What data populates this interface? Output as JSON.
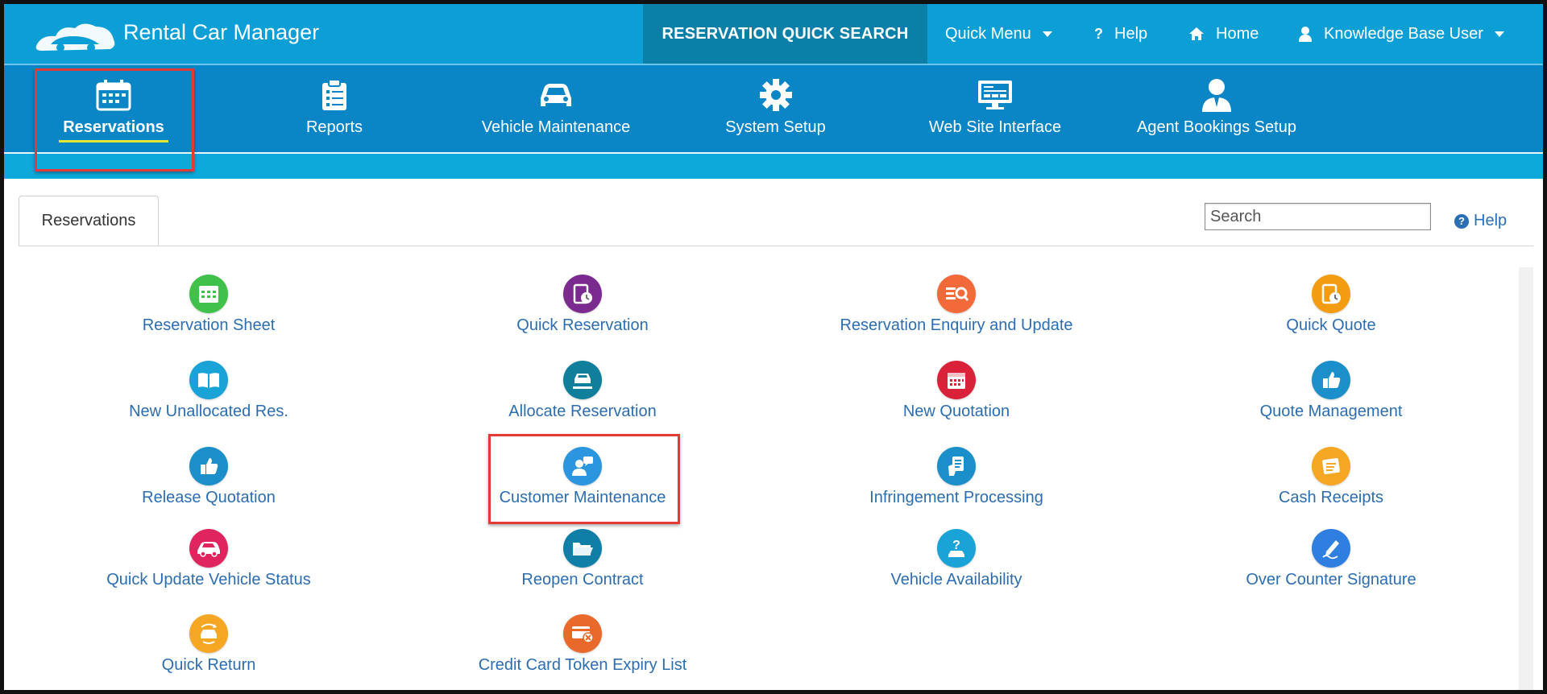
{
  "header": {
    "app_title": "Rental Car Manager",
    "quick_search_label": "RESERVATION QUICK SEARCH",
    "quick_menu_label": "Quick Menu",
    "help_label": "Help",
    "home_label": "Home",
    "user_label": "Knowledge Base User"
  },
  "nav": {
    "items": [
      {
        "label": "Reservations",
        "icon": "calendar-icon",
        "active": true
      },
      {
        "label": "Reports",
        "icon": "clipboard-list-icon"
      },
      {
        "label": "Vehicle Maintenance",
        "icon": "car-icon"
      },
      {
        "label": "System Setup",
        "icon": "gear-icon"
      },
      {
        "label": "Web Site Interface",
        "icon": "monitor-icon"
      },
      {
        "label": "Agent Bookings Setup",
        "icon": "agent-icon"
      }
    ]
  },
  "content": {
    "tab_label": "Reservations",
    "search_placeholder": "Search",
    "help_label": "Help",
    "tiles": [
      {
        "label": "Reservation Sheet",
        "icon": "calendar-grid-icon",
        "color": "#3fc14a"
      },
      {
        "label": "Quick Reservation",
        "icon": "clipboard-clock-icon",
        "color": "#7b2a8f"
      },
      {
        "label": "Reservation Enquiry and Update",
        "icon": "list-search-icon",
        "color": "#f26a3a"
      },
      {
        "label": "Quick Quote",
        "icon": "clipboard-clock-icon",
        "color": "#f39c12"
      },
      {
        "label": "New Unallocated Res.",
        "icon": "open-book-icon",
        "color": "#1aa3d6"
      },
      {
        "label": "Allocate Reservation",
        "icon": "car-hand-icon",
        "color": "#0f7f9c"
      },
      {
        "label": "New Quotation",
        "icon": "calendar-icon",
        "color": "#d9223a"
      },
      {
        "label": "Quote Management",
        "icon": "thumbs-up-icon",
        "color": "#1a8fc9"
      },
      {
        "label": "Release Quotation",
        "icon": "thumbs-up-icon",
        "color": "#1a8fc9"
      },
      {
        "label": "Customer Maintenance",
        "icon": "customer-chat-icon",
        "color": "#2b95e0"
      },
      {
        "label": "Infringement Processing",
        "icon": "hand-document-icon",
        "color": "#1a8fc9"
      },
      {
        "label": "Cash Receipts",
        "icon": "receipt-icon",
        "color": "#f5a623"
      },
      {
        "label": "Quick Update Vehicle Status",
        "icon": "car-icon",
        "color": "#e0245e"
      },
      {
        "label": "Reopen Contract",
        "icon": "open-folder-icon",
        "color": "#0f7fa8"
      },
      {
        "label": "Vehicle Availability",
        "icon": "question-car-icon",
        "color": "#1aa3d6"
      },
      {
        "label": "Over Counter Signature",
        "icon": "pen-sign-icon",
        "color": "#2f7fe0"
      },
      {
        "label": "Quick Return",
        "icon": "car-return-icon",
        "color": "#f5a623"
      },
      {
        "label": "Credit Card Token Expiry List",
        "icon": "credit-card-x-icon",
        "color": "#e8692a"
      }
    ]
  }
}
